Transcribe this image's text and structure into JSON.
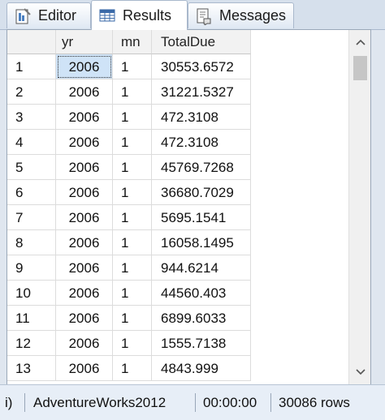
{
  "tabs": [
    {
      "label": "Editor",
      "icon": "editor-icon"
    },
    {
      "label": "Results",
      "icon": "grid-results-icon"
    },
    {
      "label": "Messages",
      "icon": "messages-icon"
    }
  ],
  "grid": {
    "columns": [
      "",
      "yr",
      "mn",
      "TotalDue"
    ],
    "rows": [
      [
        "1",
        "2006",
        "1",
        "30553.6572"
      ],
      [
        "2",
        "2006",
        "1",
        "31221.5327"
      ],
      [
        "3",
        "2006",
        "1",
        "472.3108"
      ],
      [
        "4",
        "2006",
        "1",
        "472.3108"
      ],
      [
        "5",
        "2006",
        "1",
        "45769.7268"
      ],
      [
        "6",
        "2006",
        "1",
        "36680.7029"
      ],
      [
        "7",
        "2006",
        "1",
        "5695.1541"
      ],
      [
        "8",
        "2006",
        "1",
        "16058.1495"
      ],
      [
        "9",
        "2006",
        "1",
        "944.6214"
      ],
      [
        "10",
        "2006",
        "1",
        "44560.403"
      ],
      [
        "11",
        "2006",
        "1",
        "6899.6033"
      ],
      [
        "12",
        "2006",
        "1",
        "1555.7138"
      ],
      [
        "13",
        "2006",
        "1",
        "4843.999"
      ]
    ]
  },
  "status": {
    "left_fragment": "i)",
    "database": "AdventureWorks2012",
    "elapsed": "00:00:00",
    "rows": "30086 rows"
  }
}
